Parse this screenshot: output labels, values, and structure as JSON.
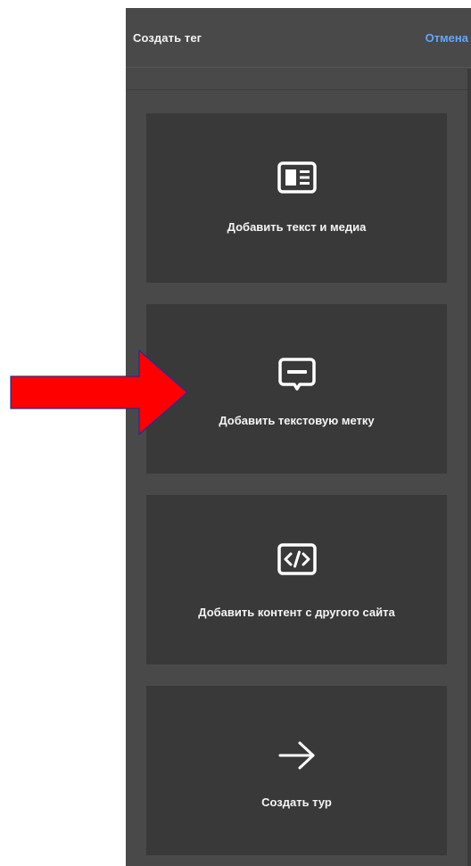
{
  "panel": {
    "title": "Создать тег",
    "cancel_label": "Отмена"
  },
  "cards": [
    {
      "label": "Добавить текст и медиа",
      "icon": "text-media-icon"
    },
    {
      "label": "Добавить текстовую метку",
      "icon": "text-label-icon"
    },
    {
      "label": "Добавить контент с другого сайта",
      "icon": "embed-code-icon"
    },
    {
      "label": "Создать тур",
      "icon": "arrow-right-icon"
    }
  ],
  "colors": {
    "panel_bg": "#494949",
    "card_bg": "#393939",
    "accent": "#5fa8ff",
    "annotation_arrow": "#ff0000"
  }
}
